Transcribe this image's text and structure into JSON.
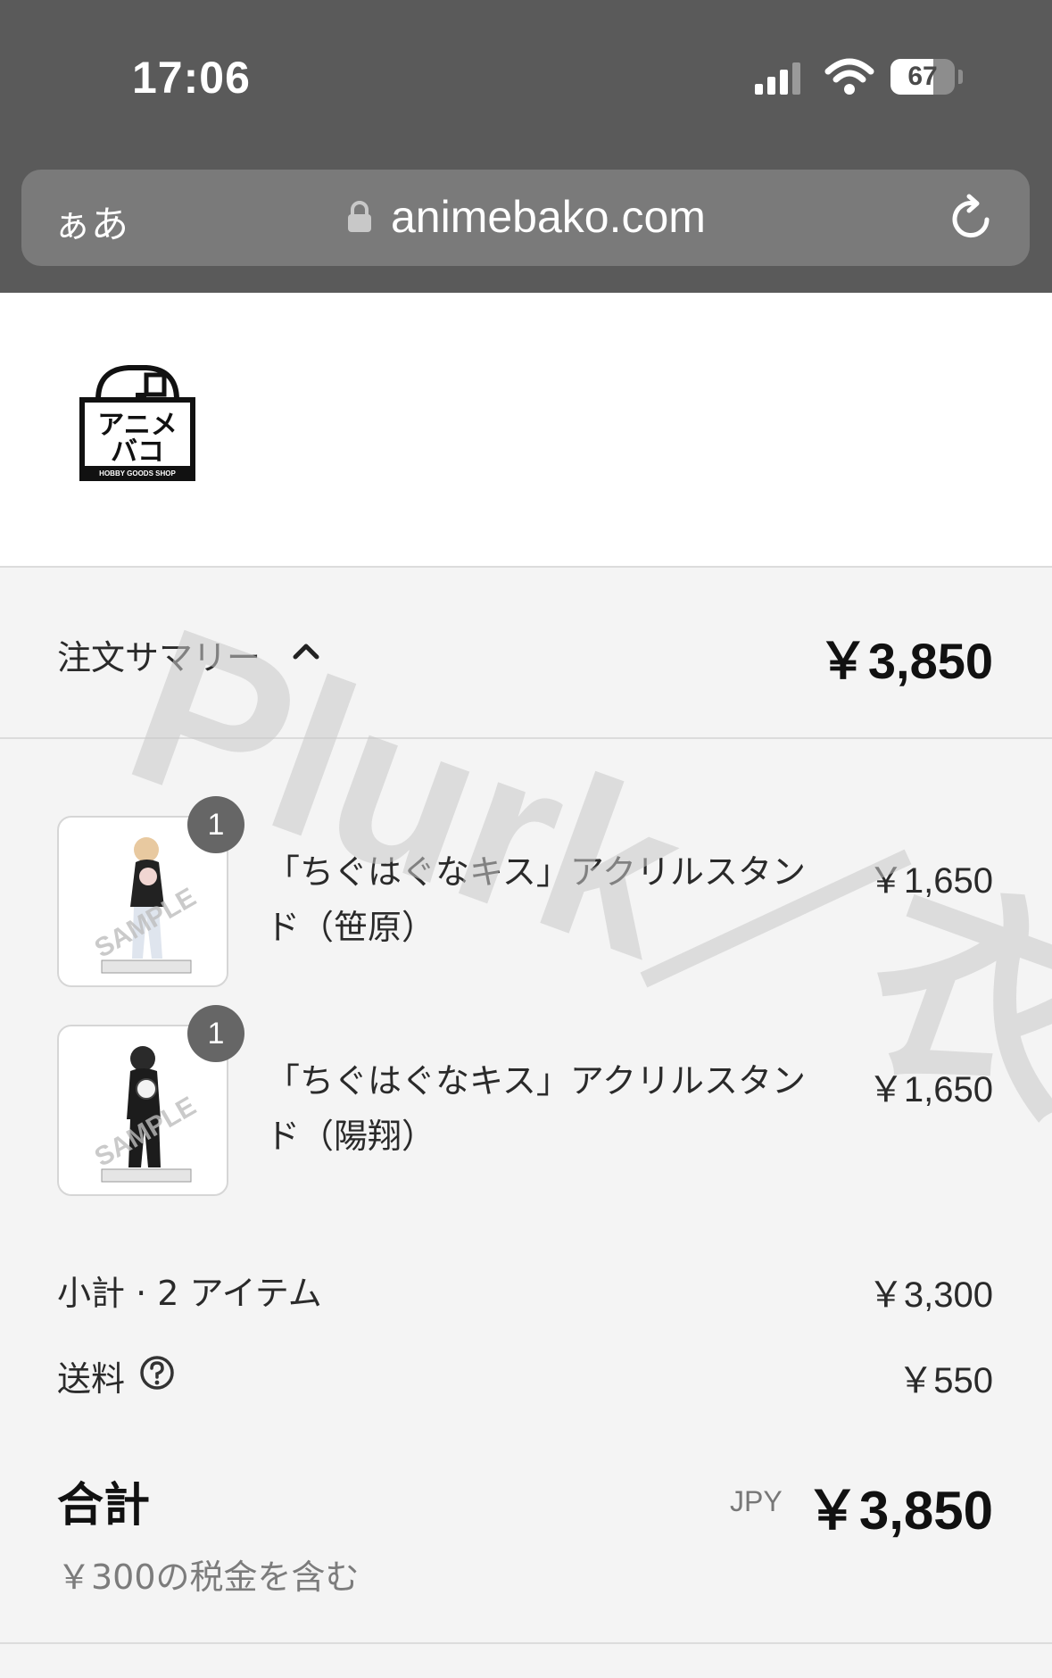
{
  "status_bar": {
    "time": "17:06",
    "battery": "67",
    "battery_level_percent": 67
  },
  "browser": {
    "text_size_label": "ぁあ",
    "url": "animebako.com",
    "icons": [
      "lock-icon",
      "reload-icon"
    ]
  },
  "logo": {
    "text_line1": "アニメ",
    "text_line2": "バコ",
    "tagline": "HOBBY GOODS SHOP"
  },
  "summary": {
    "label": "注文サマリー",
    "total": "￥3,850"
  },
  "items": [
    {
      "quantity": "1",
      "name": "「ちぐはぐなキス」アクリルスタンド（笹原）",
      "price": "￥1,650",
      "thumb_watermark": "SAMPLE"
    },
    {
      "quantity": "1",
      "name": "「ちぐはぐなキス」アクリルスタンド（陽翔）",
      "price": "￥1,650",
      "thumb_watermark": "SAMPLE"
    }
  ],
  "subtotal": {
    "label": "小計 · 2 アイテム",
    "value": "￥3,300"
  },
  "shipping": {
    "label": "送料",
    "value": "￥550"
  },
  "total": {
    "label": "合計",
    "currency": "JPY",
    "value": "￥3,850",
    "tax_note": "￥300の税金を含む"
  },
  "watermark": {
    "text": "Plurk／衣"
  },
  "colors": {
    "header_bg": "#5a5a5a",
    "urlbar_bg": "#7a7a7a",
    "page_bg": "#f4f4f4",
    "badge_bg": "#666666",
    "watermark": "#c8c8c8"
  }
}
